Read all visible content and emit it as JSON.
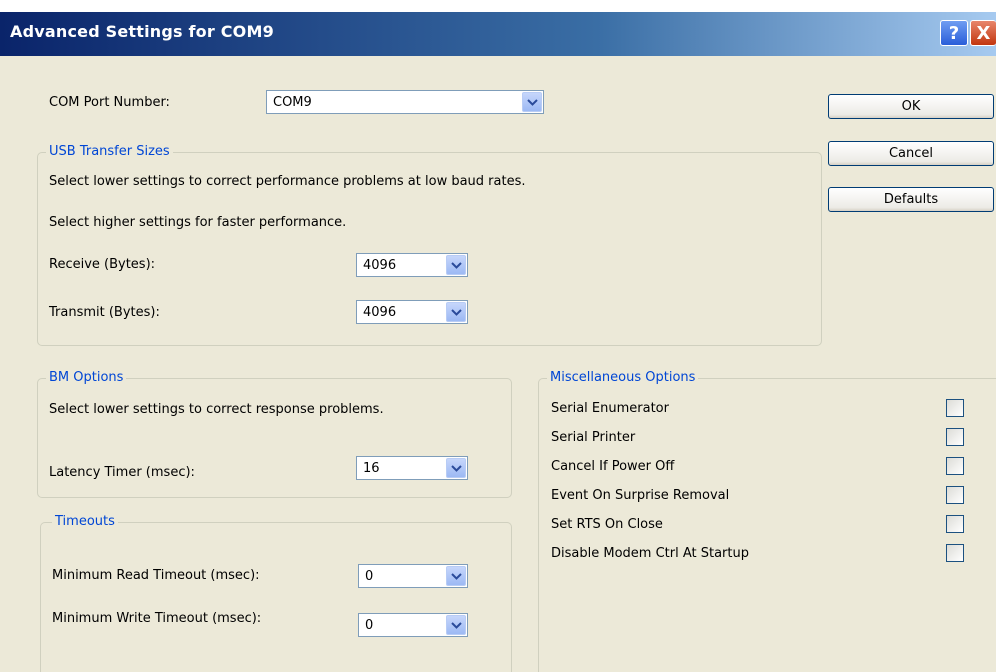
{
  "window": {
    "title": "Advanced Settings for COM9",
    "help_label": "?",
    "close_label": "X"
  },
  "com_port": {
    "label": "COM Port Number:",
    "value": "COM9"
  },
  "usb_transfer": {
    "legend": "USB Transfer Sizes",
    "desc1": "Select lower settings to correct performance problems at low baud rates.",
    "desc2": "Select higher settings for faster performance.",
    "receive_label": "Receive (Bytes):",
    "receive_value": "4096",
    "transmit_label": "Transmit (Bytes):",
    "transmit_value": "4096"
  },
  "bm_options": {
    "legend": "BM Options",
    "desc": "Select lower settings to correct response problems.",
    "latency_label": "Latency Timer (msec):",
    "latency_value": "16"
  },
  "timeouts": {
    "legend": "Timeouts",
    "read_label": "Minimum Read Timeout (msec):",
    "read_value": "0",
    "write_label": "Minimum Write Timeout (msec):",
    "write_value": "0"
  },
  "misc": {
    "legend": "Miscellaneous Options",
    "items": [
      {
        "label": "Serial Enumerator",
        "checked": false
      },
      {
        "label": "Serial Printer",
        "checked": false
      },
      {
        "label": "Cancel If Power Off",
        "checked": false
      },
      {
        "label": "Event On Surprise Removal",
        "checked": false
      },
      {
        "label": "Set RTS On Close",
        "checked": false
      },
      {
        "label": "Disable Modem Ctrl At Startup",
        "checked": false
      }
    ]
  },
  "buttons": {
    "ok": "OK",
    "cancel": "Cancel",
    "defaults": "Defaults"
  }
}
